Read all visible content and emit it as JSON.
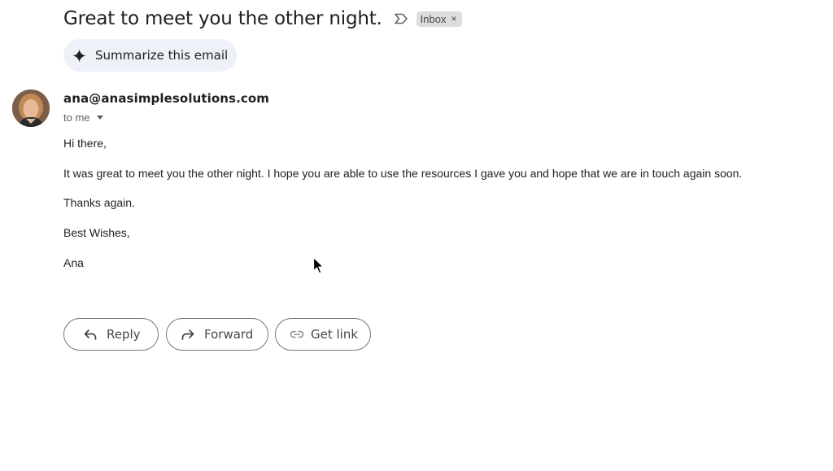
{
  "email": {
    "subject": "Great to meet you the other night.",
    "label": {
      "name": "Inbox",
      "remove_glyph": "×"
    },
    "importance_icon": "label-importance-icon"
  },
  "summarize": {
    "label": "Summarize this email",
    "icon": "sparkle-icon"
  },
  "sender": {
    "address": "ana@anasimplesolutions.com",
    "recipient": "to me",
    "avatar": "sender-photo"
  },
  "body": {
    "greeting": "Hi there,",
    "paragraph": "It was great to meet you the other night. I hope you are able to use the resources I gave you and hope that we are in touch again soon.",
    "thanks": "Thanks again.",
    "closing": "Best Wishes,",
    "signature": "Ana"
  },
  "actions": [
    {
      "label": "Reply",
      "icon": "reply-icon"
    },
    {
      "label": "Forward",
      "icon": "forward-icon"
    },
    {
      "label": "Get link",
      "icon": "link-icon"
    }
  ],
  "colors": {
    "text": "#1f1f1f",
    "secondary_text": "#5e5e5e",
    "summarize_bg": "#eef1f7",
    "chip_bg": "#dddddd",
    "button_border": "#747775"
  }
}
